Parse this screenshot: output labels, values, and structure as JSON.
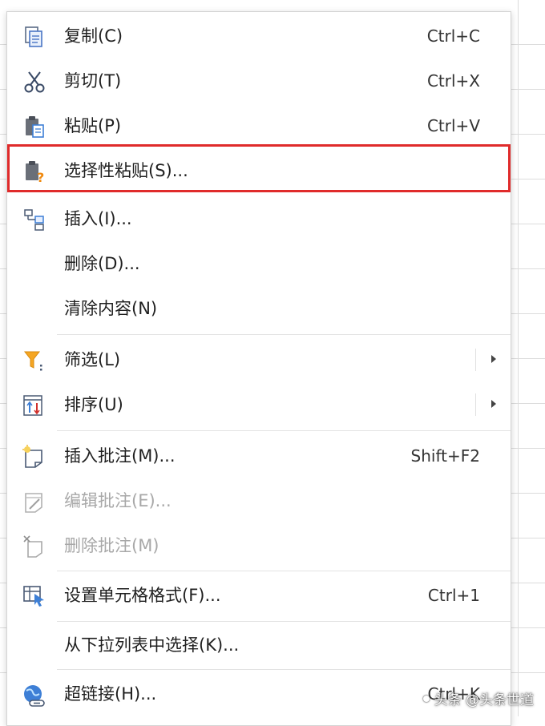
{
  "menu": {
    "items": [
      {
        "label": "复制(C)",
        "shortcut": "Ctrl+C",
        "icon": "copy-icon"
      },
      {
        "label": "剪切(T)",
        "shortcut": "Ctrl+X",
        "icon": "scissors-icon"
      },
      {
        "label": "粘贴(P)",
        "shortcut": "Ctrl+V",
        "icon": "paste-icon"
      },
      {
        "label": "选择性粘贴(S)...",
        "shortcut": "",
        "icon": "paste-special-icon"
      },
      {
        "label": "插入(I)...",
        "shortcut": "",
        "icon": "insert-cells-icon"
      },
      {
        "label": "删除(D)...",
        "shortcut": ""
      },
      {
        "label": "清除内容(N)",
        "shortcut": ""
      },
      {
        "label": "筛选(L)",
        "shortcut": "",
        "icon": "filter-icon"
      },
      {
        "label": "排序(U)",
        "shortcut": "",
        "icon": "sort-icon"
      },
      {
        "label": "插入批注(M)...",
        "shortcut": "Shift+F2",
        "icon": "insert-comment-icon"
      },
      {
        "label": "编辑批注(E)...",
        "shortcut": "",
        "icon": "edit-comment-icon",
        "disabled": true
      },
      {
        "label": "删除批注(M)",
        "shortcut": "",
        "icon": "delete-comment-icon",
        "disabled": true
      },
      {
        "label": "设置单元格格式(F)...",
        "shortcut": "Ctrl+1",
        "icon": "format-cells-icon"
      },
      {
        "label": "从下拉列表中选择(K)...",
        "shortcut": ""
      },
      {
        "label": "超链接(H)...",
        "shortcut": "Ctrl+K",
        "icon": "hyperlink-icon"
      }
    ]
  },
  "watermark": "头条 @头条世道",
  "colors": {
    "highlight": "#e02b2b",
    "separator": "#e3e3e3",
    "disabled_text": "#a8a8a8"
  }
}
